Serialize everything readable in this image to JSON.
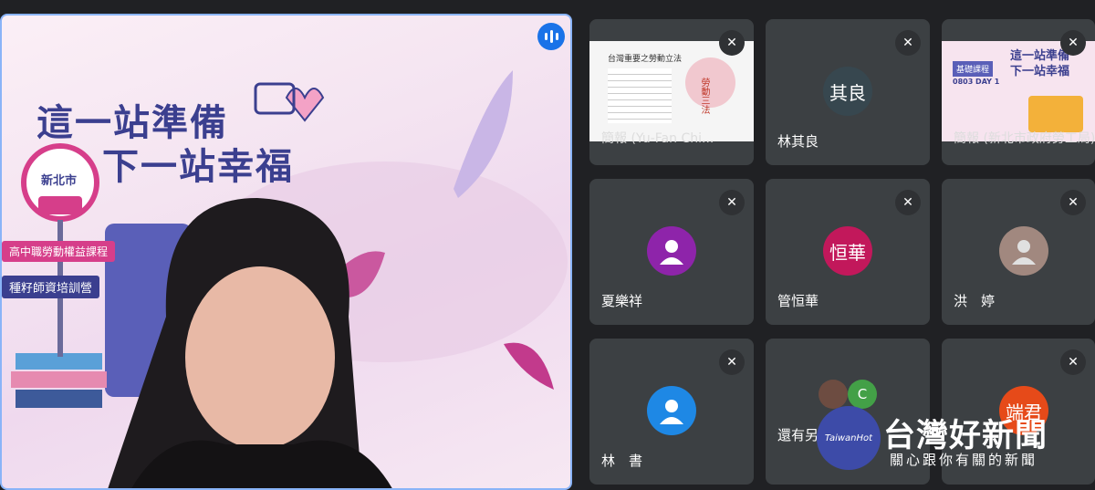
{
  "presentation": {
    "title_line1": "這一站準備",
    "title_line2": "下一站幸福",
    "badge_city": "新北市",
    "ribbon1": "高中職勞動權益課程",
    "ribbon2": "種籽師資培訓營"
  },
  "tiles": [
    {
      "name": "簡報 (Yu-Fan Chi...",
      "slide_title": "台灣重要之勞動立法",
      "slide_side": "勞動三法"
    },
    {
      "name": "林其良",
      "initials": "其良",
      "avatar_color": "#37474f"
    },
    {
      "name": "簡報 (新北市政府勞工局)",
      "slide_title": "這一站準備 下一站幸福",
      "slide_tag": "基礎課程",
      "slide_sub": "0803 DAY 1"
    },
    {
      "name": "夏樂祥",
      "avatar_color": "#8e24aa"
    },
    {
      "name": "管恒華",
      "initials": "恒華",
      "avatar_color": "#c2185b"
    },
    {
      "name": "洪　婷",
      "avatar_color": "#a1887f"
    },
    {
      "name": "林　書",
      "avatar_color": "#1e88e5"
    },
    {
      "name": "還有另外 使用者",
      "extra_initial": "C"
    },
    {
      "name": "端君",
      "initials": "端君",
      "avatar_color": "#e64a19"
    }
  ],
  "watermark": {
    "brand": "TaiwanHot",
    "title": "台灣好新聞",
    "subtitle": "關心跟你有關的新聞"
  }
}
